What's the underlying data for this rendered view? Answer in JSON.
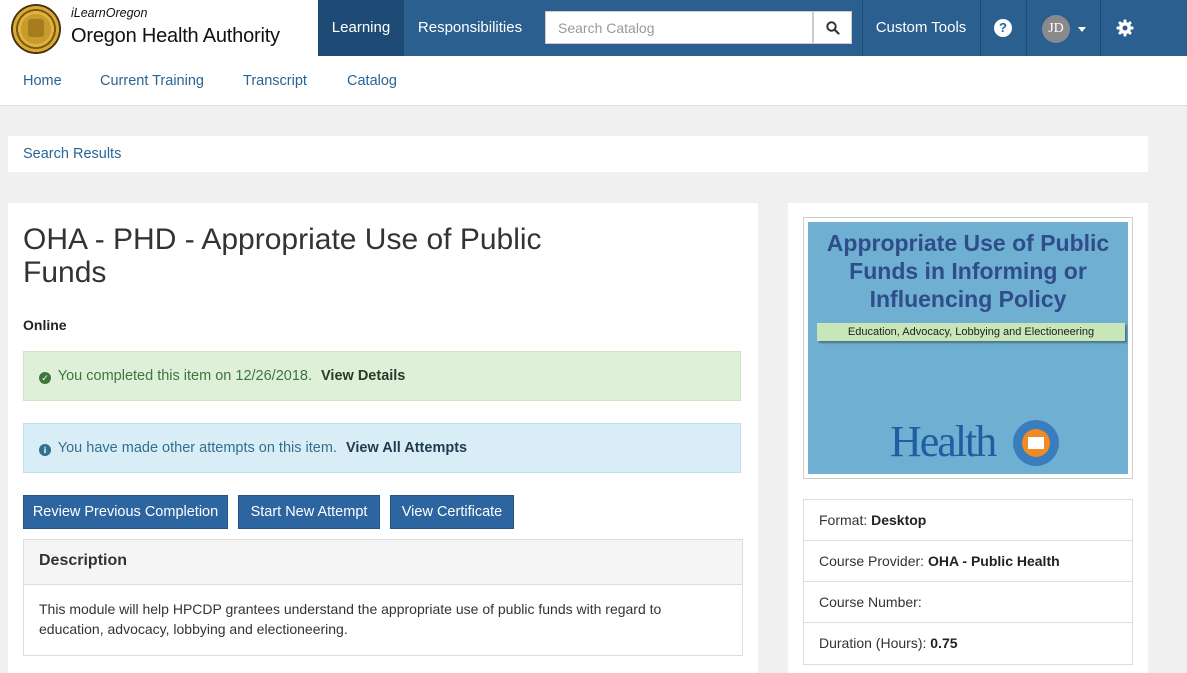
{
  "header": {
    "brand_sub": "iLearnOregon",
    "brand_main": "Oregon Health Authority",
    "nav": {
      "learning": "Learning",
      "responsibilities": "Responsibilities",
      "custom_tools": "Custom Tools"
    },
    "search_placeholder": "Search Catalog",
    "user_initials": "JD",
    "accent_color": "#2a5f8f"
  },
  "subnav": {
    "home": "Home",
    "current_training": "Current Training",
    "transcript": "Transcript",
    "catalog": "Catalog"
  },
  "breadcrumb": "Search Results",
  "course": {
    "title": "OHA - PHD - Appropriate Use of Public Funds",
    "format_label": "Online",
    "completed_text": "You completed this item on 12/26/2018.",
    "completed_link": "View Details",
    "attempts_text": "You have made other attempts on this item.",
    "attempts_link": "View All Attempts",
    "buttons": {
      "review": "Review Previous Completion",
      "start": "Start New Attempt",
      "certificate": "View Certificate"
    },
    "description_heading": "Description",
    "description": "This module will help HPCDP grantees understand the appropriate use of public funds with regard to education, advocacy, lobbying and electioneering."
  },
  "thumbnail": {
    "title": "Appropriate Use of Public Funds in Informing or Influencing Policy",
    "subtitle": "Education, Advocacy, Lobbying and Electioneering",
    "logo_text": "Health"
  },
  "details": {
    "format_label": "Format:",
    "format_value": "Desktop",
    "provider_label": "Course Provider:",
    "provider_value": "OHA - Public Health",
    "number_label": "Course Number:",
    "duration_label": "Duration (Hours):",
    "duration_value": "0.75"
  }
}
